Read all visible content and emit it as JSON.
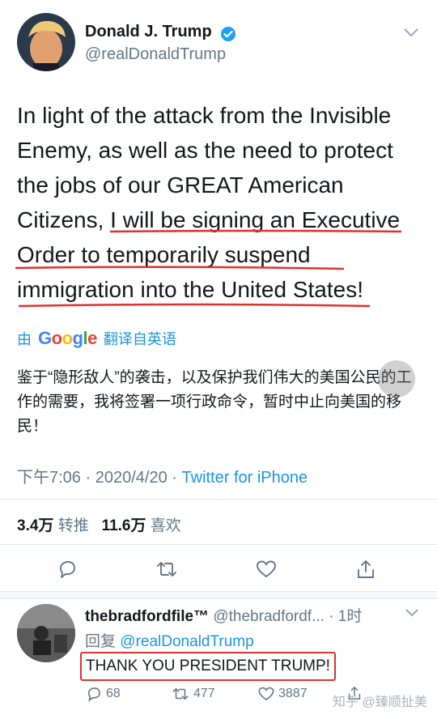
{
  "tweet": {
    "author_name": "Donald J. Trump",
    "author_handle": "@realDonaldTrump",
    "text_before": "In light of the attack from the Invisible Enemy, as well as the need to protect the jobs of our GREAT American Citizens, ",
    "text_highlight": "I will be signing an Executive Order to temporarily suspend immigration into the United States!",
    "translated_by_prefix": "由",
    "translated_by_brand": "Google",
    "translated_by_suffix": "翻译自英语",
    "translation": "鉴于“隐形敌人”的袭击，以及保护我们伟大的美国公民的工作的需要，我将签署一项行政命令，暂时中止向美国的移民！",
    "time": "下午7:06",
    "separator": "·",
    "date": "2020/4/20",
    "source": "Twitter for iPhone",
    "retweets_count": "3.4万",
    "retweets_label": "转推",
    "likes_count": "11.6万",
    "likes_label": "喜欢"
  },
  "reply": {
    "author_name": "thebradfordfile™",
    "author_handle_time": "@thebradfordf... · 1时",
    "reply_to_label": "回复",
    "reply_to_handle": "@realDonaldTrump",
    "text": "THANK YOU PRESIDENT TRUMP!",
    "replies": "68",
    "retweets": "477",
    "likes": "3887"
  },
  "watermark": "知乎 @臻顺扯美",
  "colors": {
    "accent": "#1b95e0",
    "highlight_red": "#e0312f",
    "secondary_text": "#657786"
  }
}
